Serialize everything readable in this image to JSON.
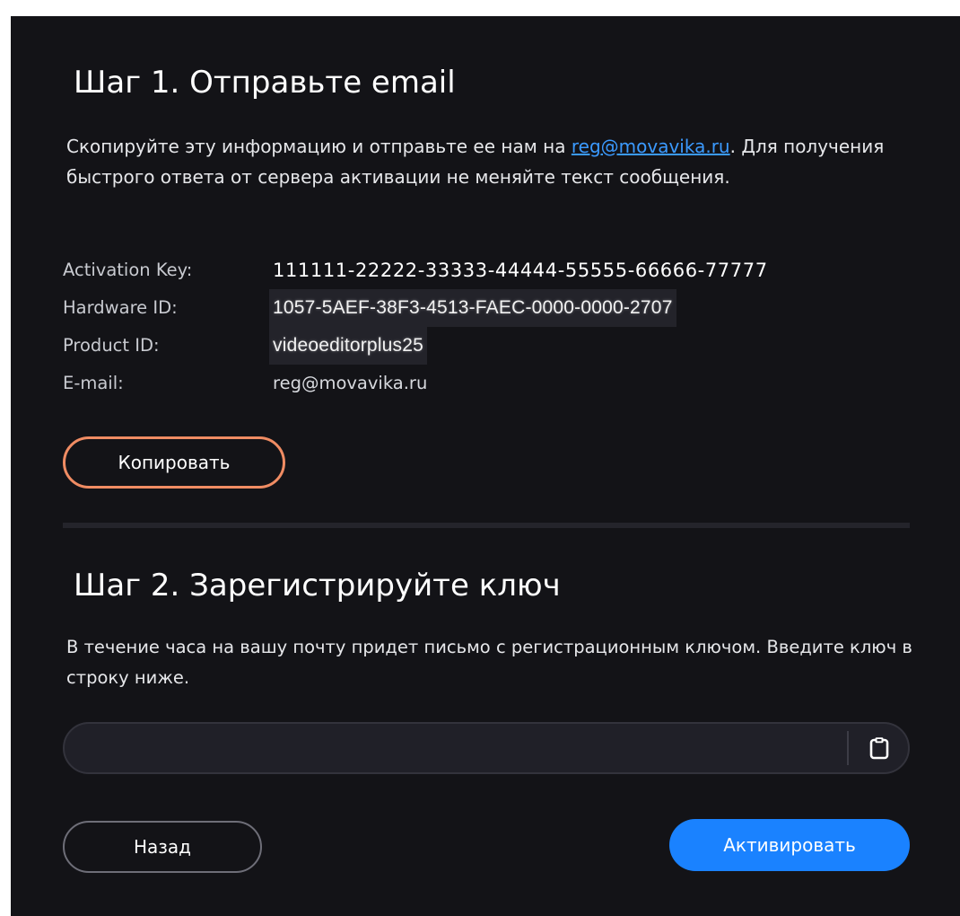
{
  "step1": {
    "title": "Шаг 1. Отправьте email",
    "desc_before": "Скопируйте эту информацию и отправьте ее нам на ",
    "email_link": "reg@movavika.ru",
    "desc_after": ". Для получения быстрого ответа от сервера активации не меняйте текст сообщения.",
    "info": [
      {
        "label": "Activation Key:",
        "value": "111111-22222-33333-44444-55555-66666-77777"
      },
      {
        "label": "Hardware ID:",
        "value": "1057-5AEF-38F3-4513-FAEC-0000-0000-2707"
      },
      {
        "label": "Product ID:",
        "value": "videoeditorplus25"
      },
      {
        "label": "E-mail:",
        "value": "reg@movavika.ru"
      }
    ],
    "copy_label": "Копировать"
  },
  "step2": {
    "title": "Шаг 2. Зарегистрируйте ключ",
    "desc": "В течение часа на вашу почту придет письмо с регистрационным ключом. Введите ключ в строку ниже.",
    "input_value": ""
  },
  "footer": {
    "back_label": "Назад",
    "activate_label": "Активировать"
  },
  "colors": {
    "background": "#131317",
    "accent": "#1a82ff",
    "link": "#3b9aff",
    "highlight": "#f08c63"
  },
  "icons": {
    "paste": "clipboard-icon"
  }
}
